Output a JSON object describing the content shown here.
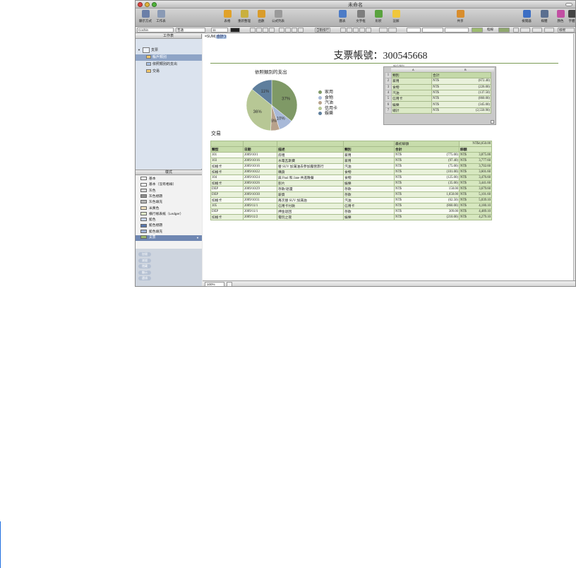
{
  "window": {
    "title": "未命名"
  },
  "toolbar": {
    "items": [
      {
        "label": "顯示方式",
        "icon": "view-icon",
        "color": "#6b7fa8"
      },
      {
        "label": "工作表",
        "icon": "sheet-icon",
        "color": "#8a9ab5"
      },
      {
        "label": "表格",
        "icon": "table-icon",
        "color": "#e1a22a"
      },
      {
        "label": "重新整理",
        "icon": "reorganize-icon",
        "color": "#c9b03e"
      },
      {
        "label": "函數",
        "icon": "function-icon",
        "color": "#d99c2b"
      },
      {
        "label": "公式列表",
        "icon": "formula-list-icon",
        "color": "#9a9a9a"
      },
      {
        "label": "圖表",
        "icon": "chart-icon",
        "color": "#4d7cc7"
      },
      {
        "label": "文字框",
        "icon": "textbox-icon",
        "color": "#7e7e7e"
      },
      {
        "label": "形狀",
        "icon": "shape-icon",
        "color": "#5aa33e"
      },
      {
        "label": "註解",
        "icon": "comment-icon",
        "color": "#f0c73c"
      },
      {
        "label": "共享",
        "icon": "share-icon",
        "color": "#d98e2e"
      },
      {
        "label": "檢閱器",
        "icon": "inspector-icon",
        "color": "#3d6fc4"
      },
      {
        "label": "媒體",
        "icon": "media-icon",
        "color": "#5b6f90"
      },
      {
        "label": "顏色",
        "icon": "colors-icon",
        "color": "#c24fa3"
      },
      {
        "label": "字體",
        "icon": "fonts-icon",
        "color": "#444444"
      }
    ]
  },
  "format_bar": {
    "font": "Cochin",
    "style": "普通",
    "size": "11",
    "wrap_label": "自動換行",
    "borders_label": "框線",
    "show_label": "檢視"
  },
  "sidebar": {
    "header": "工作表",
    "sheets": [
      {
        "label": "支票",
        "selected": false,
        "indent": 0
      },
      {
        "label": "帳戶類別",
        "selected": true,
        "indent": 1
      },
      {
        "label": "依照類別的支出",
        "selected": false,
        "indent": 1
      },
      {
        "label": "交易",
        "selected": false,
        "indent": 1
      }
    ],
    "styles_header": "樣式",
    "styles": [
      {
        "label": "基本",
        "color": "#ffffff"
      },
      {
        "label": "基本（沒有格線）",
        "color": "#ffffff"
      },
      {
        "label": "灰色",
        "color": "#d8d8d8"
      },
      {
        "label": "灰色標題",
        "color": "#8e8e8e"
      },
      {
        "label": "灰色填充",
        "color": "#b6b6b6"
      },
      {
        "label": "米黃色",
        "color": "#eedfbf"
      },
      {
        "label": "橫行帳表紙（Ledger）",
        "color": "#dfe9c9"
      },
      {
        "label": "藍色",
        "color": "#c6d4ec"
      },
      {
        "label": "藍色標題",
        "color": "#5a78ad"
      },
      {
        "label": "藍色填充",
        "color": "#9fb2d6"
      },
      {
        "label": "支票",
        "color": "#9cbb6e",
        "selected": true
      }
    ],
    "buttons": [
      "加號",
      "減號",
      "隱藏",
      "顯示",
      "選項"
    ]
  },
  "canvas": {
    "formula_prefix": "=SUM(",
    "formula_token": "合計 )",
    "doc_title": "支票帳號：300545668",
    "transactions_caption": "交易",
    "summary_caption": "帳戶類別"
  },
  "chart_data": {
    "type": "pie",
    "title": "依照類別的支出",
    "categories": [
      "家用",
      "食物",
      "汽油",
      "信用卡",
      "娛樂"
    ],
    "values": [
      872.4,
      226.0,
      137.5,
      860.0,
      345.0
    ],
    "labels": [
      "37%",
      "10%",
      "6%",
      "36%",
      "11%"
    ],
    "colors": [
      "#7f9966",
      "#a8b9d8",
      "#b8a28c",
      "#b7c795",
      "#5f7f9d"
    ]
  },
  "summary_table": {
    "col_letters": [
      "A",
      "B"
    ],
    "header": [
      "類別",
      "合計"
    ],
    "rows": [
      {
        "n": "2",
        "cat": "家用",
        "cur": "NT$",
        "val": "(872.40)"
      },
      {
        "n": "3",
        "cat": "食物",
        "cur": "NT$",
        "val": "(226.00)"
      },
      {
        "n": "4",
        "cat": "汽油",
        "cur": "NT$",
        "val": "(137.50)"
      },
      {
        "n": "5",
        "cat": "信用卡",
        "cur": "NT$",
        "val": "(860.00)"
      },
      {
        "n": "6",
        "cat": "娛樂",
        "cur": "NT$",
        "val": "(345.00)"
      },
      {
        "n": "7",
        "cat": "總計",
        "cur": "NT$",
        "val": "(2,550.90)"
      }
    ]
  },
  "transactions": {
    "opening_label": "最初餘額",
    "opening_value": "NT$4,650.00",
    "headers": [
      "類型",
      "日期",
      "描述",
      "類別",
      "合計",
      "餘額"
    ],
    "rows": [
      [
        "101",
        "2009/10/1",
        "房租",
        "家用",
        "NT$",
        "(775.00)",
        "NT$",
        "3,875.00"
      ],
      [
        "103",
        "2009/10/16",
        "水電瓦斯費",
        "家用",
        "NT$",
        "(97.40)",
        "NT$",
        "3,777.60"
      ],
      [
        "扣帳卡",
        "2009/10/16",
        "替 SUV 加滿油去參加露營旅行",
        "汽油",
        "NT$",
        "(75.00)",
        "NT$",
        "3,702.60"
      ],
      [
        "扣帳卡",
        "2009/10/22",
        "購貨",
        "食物",
        "NT$",
        "(101.00)",
        "NT$",
        "3,601.60"
      ],
      [
        "104",
        "2009/10/24",
        "與 Paul 和 Jane 共進晚餐",
        "食物",
        "NT$",
        "(125.00)",
        "NT$",
        "3,476.60"
      ],
      [
        "扣帳卡",
        "2009/10/26",
        "影片",
        "娛樂",
        "NT$",
        "(35.00)",
        "NT$",
        "3,441.60"
      ],
      [
        "DEP",
        "2009/10/29",
        "存款/退還",
        "存款",
        "NT$",
        "158.00",
        "NT$",
        "3,679.60"
      ],
      [
        "DEP",
        "2009/10/30",
        "薪資",
        "存款",
        "NT$",
        "1,658.00",
        "NT$",
        "5,101.60"
      ],
      [
        "扣帳卡",
        "2009/10/31",
        "再次替 SUV 加滿油",
        "汽油",
        "NT$",
        "(62.50)",
        "NT$",
        "5,039.10"
      ],
      [
        "105",
        "2009/11/1",
        "信用卡付款",
        "信用卡",
        "NT$",
        "(860.00)",
        "NT$",
        "4,180.10"
      ],
      [
        "DEP",
        "2009/11/1",
        "押金退回",
        "存款",
        "NT$",
        "309.00",
        "NT$",
        "4,489.10"
      ],
      [
        "扣帳卡",
        "2009/11/2",
        "電玩之夜",
        "娛樂",
        "NT$",
        "(210.00)",
        "NT$",
        "4,279.10"
      ]
    ]
  },
  "status": {
    "zoom": "100%"
  }
}
